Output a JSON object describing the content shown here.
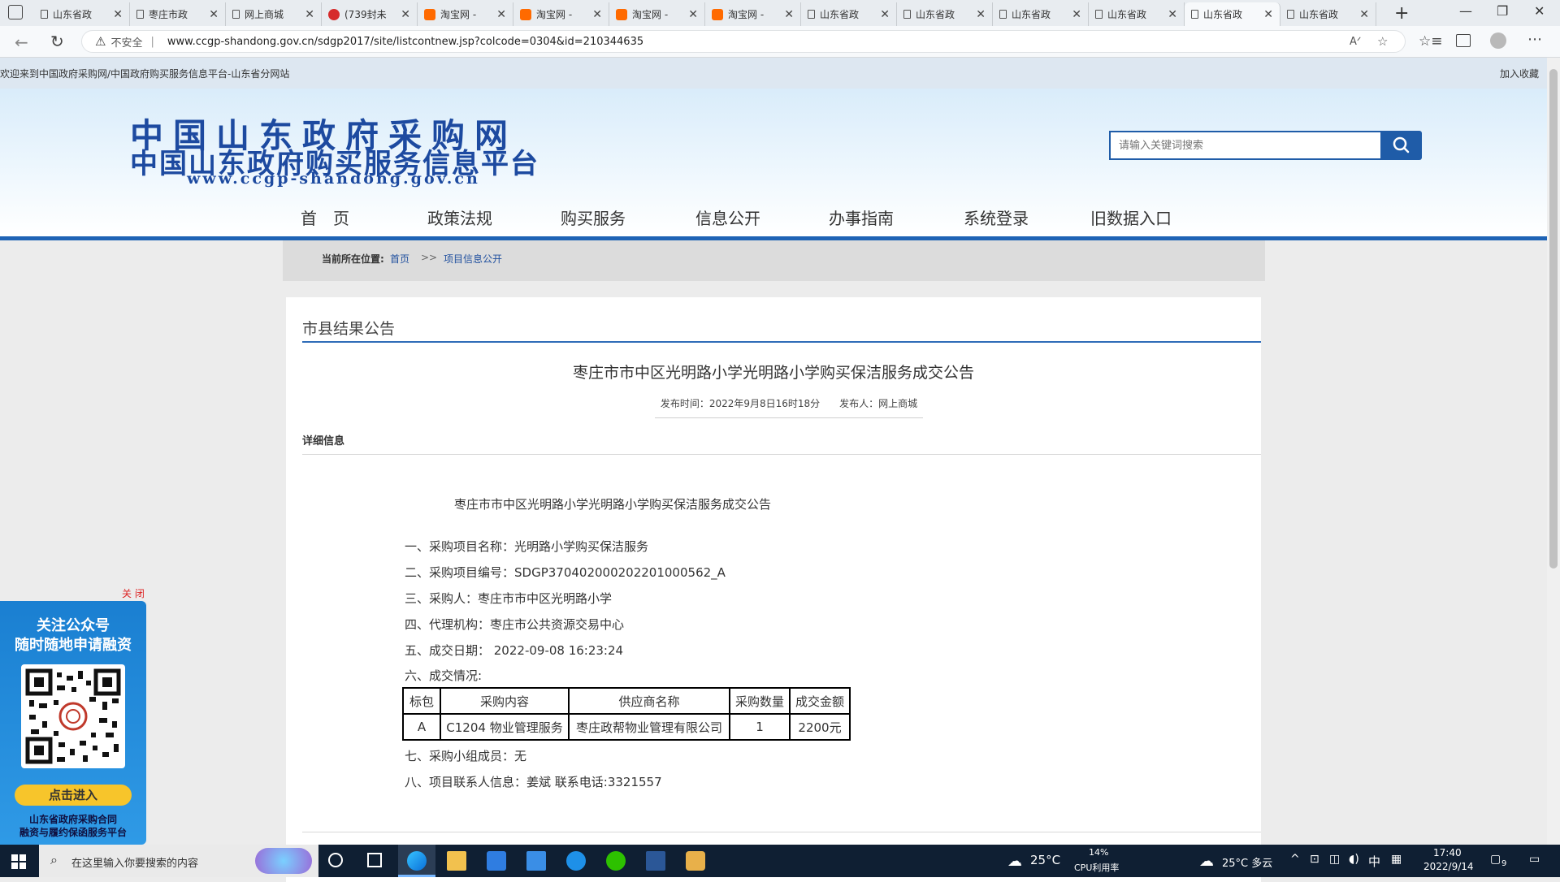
{
  "browser": {
    "tabs": [
      {
        "title": "山东省政",
        "icon": "page"
      },
      {
        "title": "枣庄市政",
        "icon": "page"
      },
      {
        "title": "网上商城",
        "icon": "page"
      },
      {
        "title": "(739封未",
        "icon": "red"
      },
      {
        "title": "淘宝网 - ",
        "icon": "taobao"
      },
      {
        "title": "淘宝网 - ",
        "icon": "taobao"
      },
      {
        "title": "淘宝网 - ",
        "icon": "taobao"
      },
      {
        "title": "淘宝网 - ",
        "icon": "taobao"
      },
      {
        "title": "山东省政",
        "icon": "page"
      },
      {
        "title": "山东省政",
        "icon": "page"
      },
      {
        "title": "山东省政",
        "icon": "page"
      },
      {
        "title": "山东省政",
        "icon": "page"
      },
      {
        "title": "山东省政",
        "icon": "page"
      },
      {
        "title": "山东省政",
        "icon": "page"
      }
    ],
    "security_label": "不安全",
    "url": "www.ccgp-shandong.gov.cn/sdgp2017/site/listcontnew.jsp?colcode=0304&id=210344635"
  },
  "site": {
    "welcome": "欢迎来到中国政府采购网/中国政府购买服务信息平台-山东省分网站",
    "bookmark": "加入收藏",
    "logo_line1": "中国山东政府采购网",
    "logo_line2": "中国山东政府购买服务信息平台",
    "logo_url": "www.ccgp-shandong.gov.cn",
    "search_placeholder": "请输入关键词搜索",
    "nav": [
      "首　页",
      "政策法规",
      "购买服务",
      "信息公开",
      "办事指南",
      "系统登录",
      "旧数据入口"
    ]
  },
  "breadcrumb": {
    "label": "当前所在位置:",
    "home": "首页",
    "sep": ">>",
    "current": "项目信息公开"
  },
  "article": {
    "section": "市县结果公告",
    "title": "枣庄市市中区光明路小学光明路小学购买保洁服务成交公告",
    "meta": "发布时间：2022年9月8日16时18分　　发布人：网上商城",
    "detail_label": "详细信息",
    "inner_title": "枣庄市市中区光明路小学光明路小学购买保洁服务成交公告",
    "lines": [
      "一、采购项目名称：光明路小学购买保洁服务",
      "二、采购项目编号：SDGP370402000202201000562_A",
      "三、采购人：枣庄市市中区光明路小学",
      "四、代理机构：枣庄市公共资源交易中心",
      "五、成交日期： 2022-09-08 16:23:24",
      "六、成交情况:"
    ],
    "table": {
      "headers": [
        "标包",
        "采购内容",
        "供应商名称",
        "采购数量",
        "成交金额"
      ],
      "rows": [
        [
          "A",
          "C1204 物业管理服务",
          "枣庄政帮物业管理有限公司",
          "1",
          "2200元"
        ]
      ]
    },
    "lines_after": [
      "七、采购小组成员：无",
      "八、项目联系人信息：姜斌 联系电话:3321557"
    ]
  },
  "ad": {
    "close": "关 闭",
    "line1": "关注公众号",
    "line2": "随时随地申请融资",
    "button": "点击进入",
    "footer1": "山东省政府采购合同",
    "footer2": "融资与履约保函服务平台"
  },
  "taskbar": {
    "search_placeholder": "在这里输入你要搜索的内容",
    "weather1": "25°C",
    "cpu_pct": "14%",
    "cpu_label": "CPU利用率",
    "weather2": "25°C  多云",
    "ime": "中",
    "time": "17:40",
    "date": "2022/9/14",
    "notif": "9"
  }
}
